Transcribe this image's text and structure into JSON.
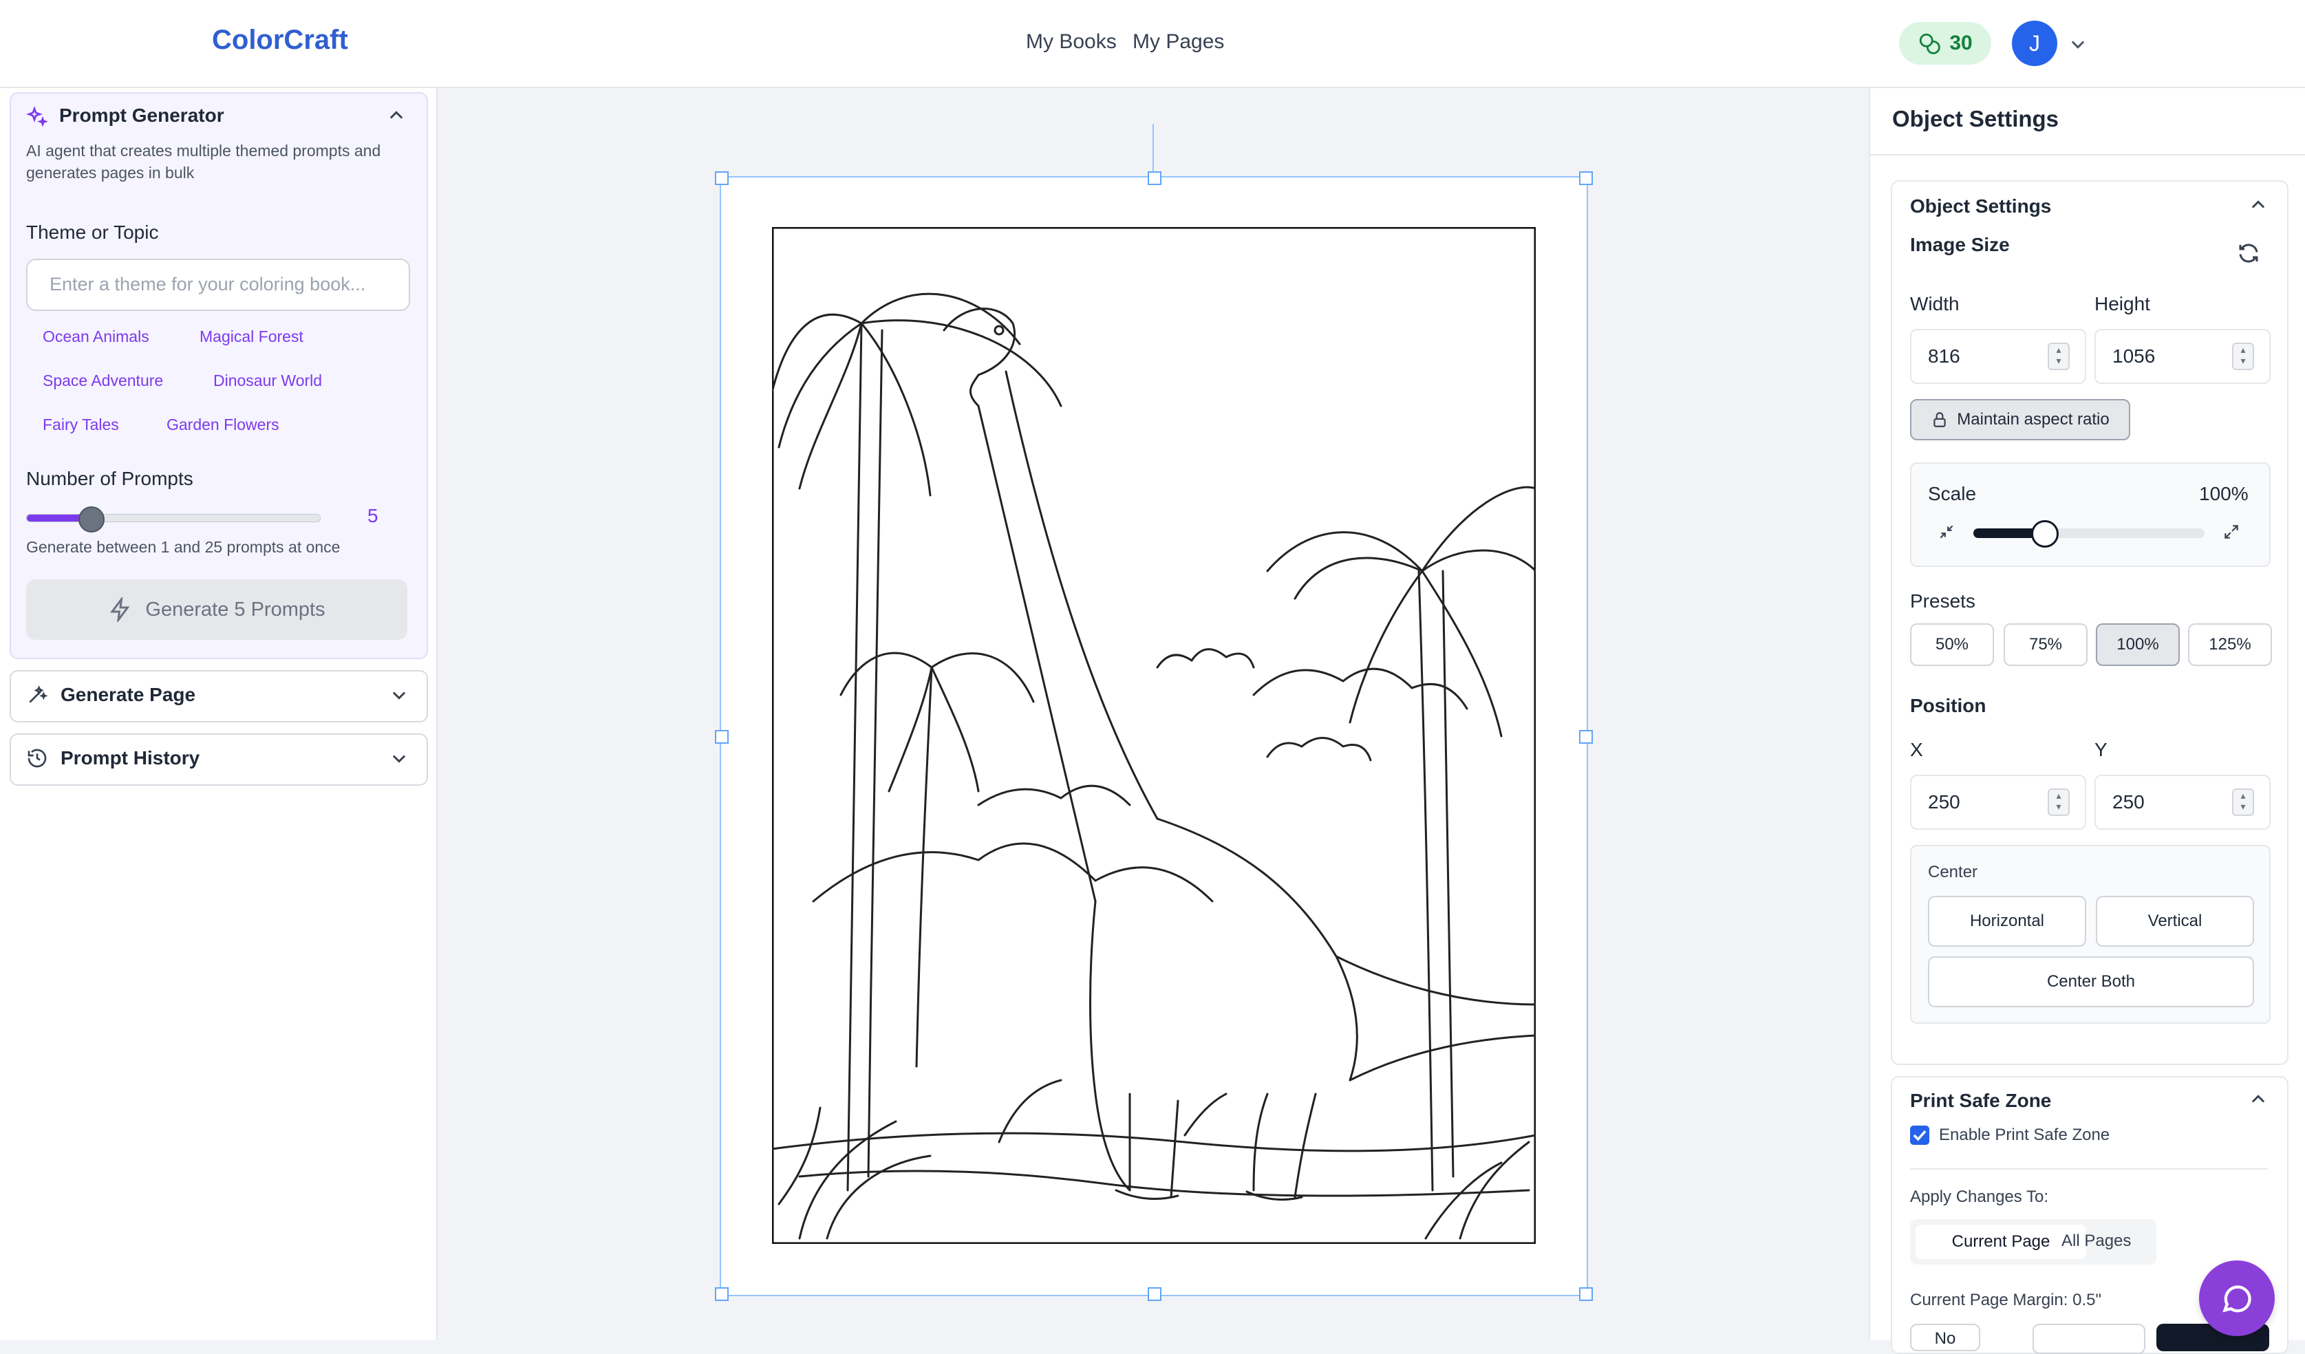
{
  "app": {
    "brand": "ColorCraft",
    "credits": "30",
    "avatar_initial": "J"
  },
  "nav": {
    "books": "My Books",
    "pages": "My Pages"
  },
  "prompt_generator": {
    "title": "Prompt Generator",
    "description_line1": "AI agent that creates multiple themed prompts and",
    "description_line2": "generates pages in bulk",
    "theme_label": "Theme or Topic",
    "theme_placeholder": "Enter a theme for your coloring book...",
    "chips": [
      "Ocean Animals",
      "Magical Forest",
      "Space Adventure",
      "Dinosaur World",
      "Fairy Tales",
      "Garden Flowers"
    ],
    "count_label": "Number of Prompts",
    "count_value": "5",
    "count_range": {
      "min": 1,
      "max": 25,
      "value": 5
    },
    "count_help": "Generate between 1 and 25 prompts at once",
    "generate_button": "Generate 5 Prompts"
  },
  "generate_page": {
    "title": "Generate Page"
  },
  "prompt_history": {
    "title": "Prompt History"
  },
  "object_panel": {
    "title": "Object Settings",
    "card_title": "Object Settings",
    "image_size": "Image Size",
    "width_label": "Width",
    "width_value": "816",
    "height_label": "Height",
    "height_value": "1056",
    "aspect_button": "Maintain aspect ratio",
    "scale_label": "Scale",
    "scale_value": "100%",
    "scale_fraction": 0.3,
    "presets_label": "Presets",
    "presets": [
      "50%",
      "75%",
      "100%",
      "125%"
    ],
    "preset_selected": "100%",
    "position_label": "Position",
    "x_label": "X",
    "x_value": "250",
    "y_label": "Y",
    "y_value": "250",
    "center_label": "Center",
    "horizontal": "Horizontal",
    "vertical": "Vertical",
    "center_both": "Center Both"
  },
  "print_safe": {
    "title": "Print Safe Zone",
    "enable_label": "Enable Print Safe Zone",
    "enabled": true,
    "apply_label": "Apply Changes To:",
    "current_page": "Current Page",
    "all_pages": "All Pages",
    "margin_label": "Current Page Margin: 0.5\"",
    "margin_first_option": "No"
  },
  "colors": {
    "brand": "#2f5fd0",
    "accent": "#7c3aed",
    "chat": "#8b3fd9"
  },
  "icons": [
    "sparkles-icon",
    "chevron-up-icon",
    "chevron-down-icon",
    "wand-icon",
    "history-icon",
    "bolt-icon",
    "refresh-icon",
    "lock-icon",
    "shrink-icon",
    "expand-icon",
    "chat-icon",
    "coins-icon"
  ]
}
